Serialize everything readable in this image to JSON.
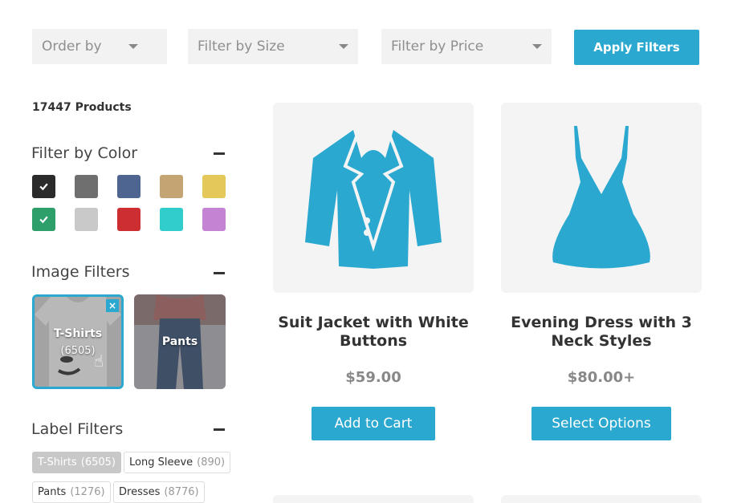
{
  "filters": {
    "order_by": "Order by",
    "size": "Filter by Size",
    "price": "Filter by Price",
    "apply_label": "Apply Filters"
  },
  "sidebar": {
    "product_count": "17447 Products",
    "color_section": {
      "title": "Filter by Color",
      "swatches": [
        {
          "color": "#2b2b2b",
          "checked": true
        },
        {
          "color": "#6f6f6f",
          "checked": false
        },
        {
          "color": "#4e6491",
          "checked": false
        },
        {
          "color": "#c4a473",
          "checked": false
        },
        {
          "color": "#e4c95a",
          "checked": false
        },
        {
          "color": "#2e9e6b",
          "checked": true
        },
        {
          "color": "#c9c9c9",
          "checked": false
        },
        {
          "color": "#cc2e31",
          "checked": false
        },
        {
          "color": "#31cccc",
          "checked": false
        },
        {
          "color": "#c583d4",
          "checked": false
        }
      ]
    },
    "image_section": {
      "title": "Image Filters",
      "items": [
        {
          "label": "T-Shirts",
          "count": "(6505)",
          "selected": true
        },
        {
          "label": "Pants",
          "count": "",
          "selected": false
        }
      ]
    },
    "label_section": {
      "title": "Label Filters",
      "tags": [
        {
          "label": "T-Shirts",
          "count": "(6505)",
          "active": true
        },
        {
          "label": "Long Sleeve",
          "count": "(890)",
          "active": false
        },
        {
          "label": "Pants",
          "count": "(1276)",
          "active": false
        },
        {
          "label": "Dresses",
          "count": "(8776)",
          "active": false
        }
      ]
    }
  },
  "products": [
    {
      "title": "Suit Jacket with White Buttons",
      "price": "$59.00",
      "button": "Add to Cart",
      "icon": "jacket-icon"
    },
    {
      "title": "Evening Dress with 3 Neck Styles",
      "price": "$80.00+",
      "button": "Select Options",
      "icon": "dress-icon"
    }
  ],
  "colors": {
    "accent": "#2aa8cf",
    "select_bg": "#f2f2f2",
    "product_bg": "#f4f4f4"
  }
}
